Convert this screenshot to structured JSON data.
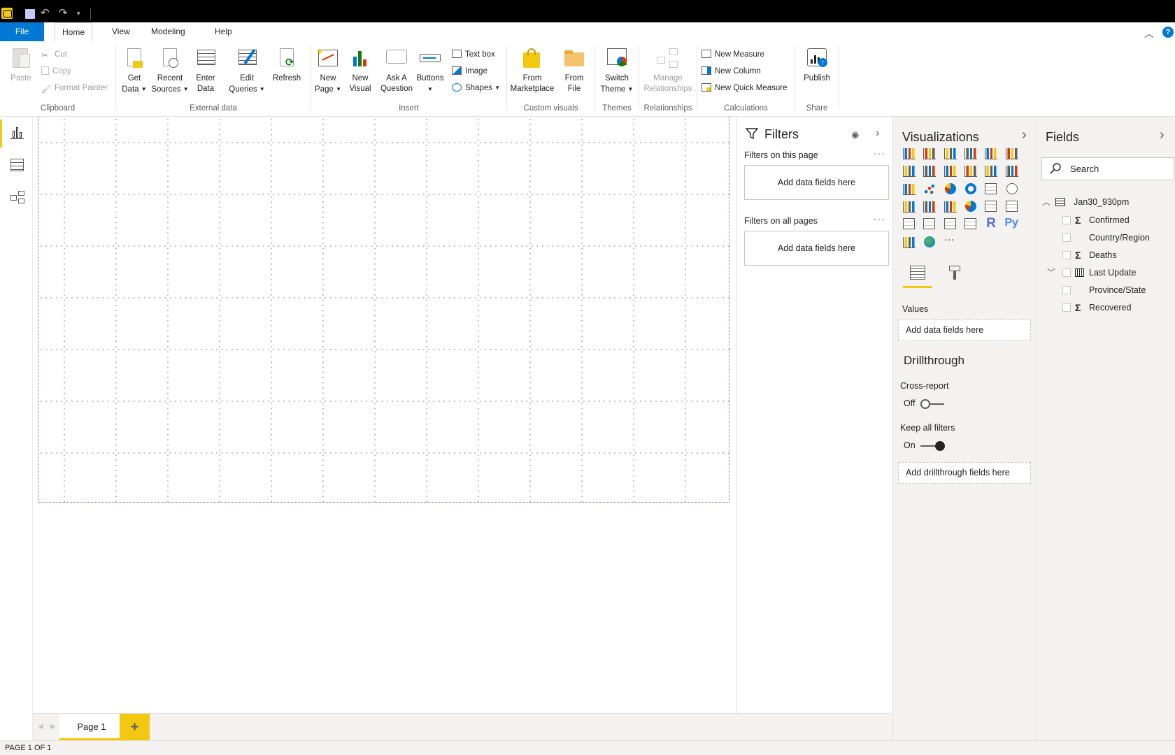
{
  "menu": {
    "tabs": [
      "File",
      "Home",
      "View",
      "Modeling",
      "Help"
    ]
  },
  "ribbon": {
    "clipboard": {
      "paste": "Paste",
      "cut": "Cut",
      "copy": "Copy",
      "format_painter": "Format Painter",
      "label": "Clipboard"
    },
    "external_data": {
      "get_data": [
        "Get",
        "Data"
      ],
      "recent_sources": [
        "Recent",
        "Sources"
      ],
      "enter_data": [
        "Enter",
        "Data"
      ],
      "edit_queries": [
        "Edit",
        "Queries"
      ],
      "refresh": "Refresh",
      "label": "External data"
    },
    "insert": {
      "new_page": [
        "New",
        "Page"
      ],
      "new_visual": [
        "New",
        "Visual"
      ],
      "ask_question": [
        "Ask A",
        "Question"
      ],
      "buttons": "Buttons",
      "text_box": "Text box",
      "image": "Image",
      "shapes": "Shapes",
      "label": "Insert"
    },
    "custom_visuals": {
      "from_marketplace": [
        "From",
        "Marketplace"
      ],
      "from_file": [
        "From",
        "File"
      ],
      "label": "Custom visuals"
    },
    "themes": {
      "switch_theme": [
        "Switch",
        "Theme"
      ],
      "label": "Themes"
    },
    "relationships": {
      "manage": [
        "Manage",
        "Relationships"
      ],
      "label": "Relationships"
    },
    "calculations": {
      "new_measure": "New Measure",
      "new_column": "New Column",
      "new_quick_measure": "New Quick Measure",
      "label": "Calculations"
    },
    "share": {
      "publish": "Publish",
      "label": "Share"
    }
  },
  "page_tabs": {
    "page1": "Page 1",
    "add": "+"
  },
  "status": {
    "text": "PAGE 1 OF 1"
  },
  "filters": {
    "title": "Filters",
    "this_page": "Filters on this page",
    "all_pages": "Filters on all pages",
    "add_fields": "Add data fields here",
    "more": "···"
  },
  "visualizations": {
    "title": "Visualizations",
    "values_label": "Values",
    "values_well": "Add data fields here",
    "drillthrough_title": "Drillthrough",
    "cross_report": "Cross-report",
    "cross_report_state": "Off",
    "keep_filters": "Keep all filters",
    "keep_filters_state": "On",
    "drillthrough_well": "Add drillthrough fields here",
    "r_label": "R",
    "py_label": "Py",
    "more": "···"
  },
  "fields": {
    "title": "Fields",
    "search_placeholder": "Search",
    "table_name": "Jan30_930pm",
    "items": [
      {
        "label": "Confirmed",
        "sigma": "Σ"
      },
      {
        "label": "Country/Region",
        "sigma": ""
      },
      {
        "label": "Deaths",
        "sigma": "Σ"
      },
      {
        "label": "Last Update",
        "sigma": ""
      },
      {
        "label": "Province/State",
        "sigma": ""
      },
      {
        "label": "Recovered",
        "sigma": "Σ"
      }
    ]
  },
  "colors": {
    "accent": "#f2c811",
    "file_tab": "#0078d4"
  }
}
